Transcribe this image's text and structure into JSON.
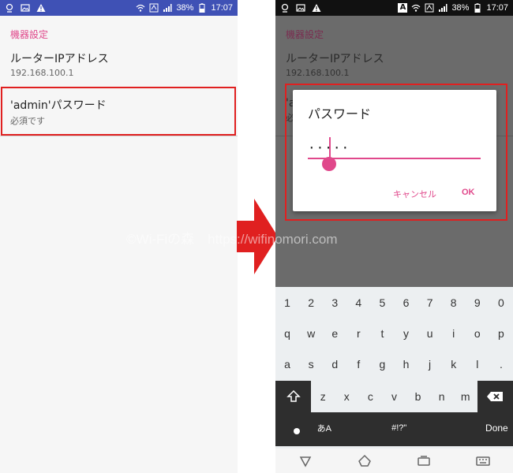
{
  "status_bar": {
    "battery": "38%",
    "time": "17:07",
    "input_indicator": "A"
  },
  "settings": {
    "section_title": "機器設定",
    "router_ip": {
      "title": "ルーターIPアドレス",
      "value": "192.168.100.1"
    },
    "admin_password": {
      "title": "'admin'パスワード",
      "summary": "必須です",
      "summary_partial": "必",
      "title_partial": "'a"
    }
  },
  "dialog": {
    "title": "パスワード",
    "masked_value": "·····",
    "cancel_label": "キャンセル",
    "ok_label": "OK"
  },
  "watermark": "©Wi-Fiの森　https://wifinomori.com",
  "keyboard": {
    "row1": [
      "1",
      "2",
      "3",
      "4",
      "5",
      "6",
      "7",
      "8",
      "9",
      "0"
    ],
    "row2": [
      "q",
      "w",
      "e",
      "r",
      "t",
      "y",
      "u",
      "i",
      "o",
      "p"
    ],
    "row3": [
      "a",
      "s",
      "d",
      "f",
      "g",
      "h",
      "j",
      "k",
      "l",
      "."
    ],
    "row4": [
      "z",
      "x",
      "c",
      "v",
      "b",
      "n",
      "m"
    ],
    "lang_key": "あA",
    "symbol_key": "#!?\"",
    "done_label": "Done"
  },
  "colors": {
    "accent": "#e0488b",
    "highlight_box": "#e02020",
    "status_bar_left": "#3f51b5",
    "arrow": "#e02020"
  },
  "icons": {
    "status_left": [
      "notification-icon",
      "image-icon",
      "warning-icon"
    ],
    "status_right": [
      "wifi-icon",
      "signal-icon",
      "battery-icon"
    ],
    "nav": [
      "back-icon",
      "home-icon",
      "recents-icon",
      "keyboard-switch-icon"
    ]
  }
}
